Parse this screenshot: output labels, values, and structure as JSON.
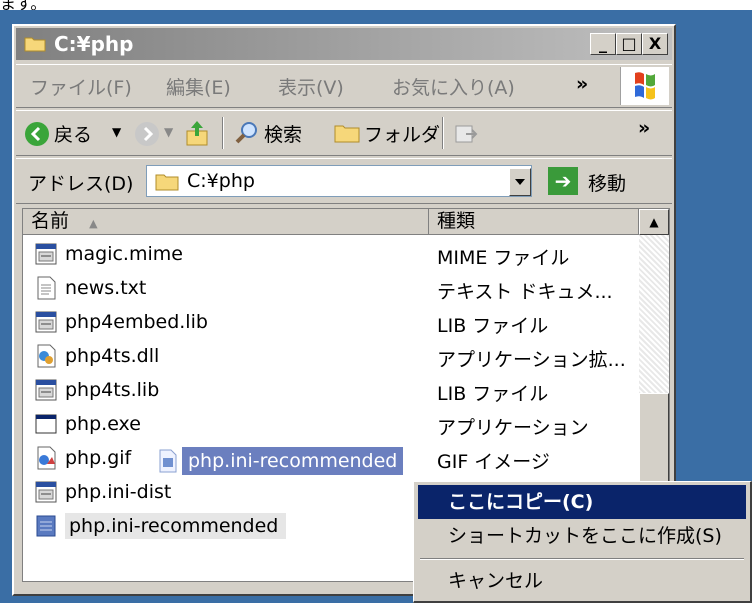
{
  "top_strip_text": "ます。",
  "window": {
    "title": "C:¥php",
    "controls": {
      "minimize": "_",
      "maximize": "□",
      "close": "X"
    }
  },
  "menubar": {
    "items": [
      "ファイル(F)",
      "編集(E)",
      "表示(V)",
      "お気に入り(A)"
    ],
    "chevron": "»"
  },
  "toolbar": {
    "back": "戻る",
    "search": "検索",
    "folders": "フォルダ",
    "chevron": "»"
  },
  "address": {
    "label": "アドレス(D)",
    "value": "C:¥php",
    "go": "移動"
  },
  "list": {
    "headers": {
      "name": "名前",
      "type": "種類"
    },
    "rows": [
      {
        "name": "magic.mime",
        "type": "MIME ファイル",
        "icon": "lib-file-icon"
      },
      {
        "name": "news.txt",
        "type": "テキスト ドキュメ...",
        "icon": "text-file-icon"
      },
      {
        "name": "php4embed.lib",
        "type": "LIB ファイル",
        "icon": "lib-file-icon"
      },
      {
        "name": "php4ts.dll",
        "type": "アプリケーション拡...",
        "icon": "dll-file-icon"
      },
      {
        "name": "php4ts.lib",
        "type": "LIB ファイル",
        "icon": "lib-file-icon"
      },
      {
        "name": "php.exe",
        "type": "アプリケーション",
        "icon": "exe-file-icon"
      },
      {
        "name": "php.gif",
        "type": "GIF イメージ",
        "icon": "gif-file-icon"
      },
      {
        "name": "php.ini-dist",
        "type": "",
        "icon": "lib-file-icon"
      },
      {
        "name": "php.ini-recommended",
        "type": "",
        "icon": "ini-file-icon"
      }
    ]
  },
  "drag_ghost": {
    "label": "php.ini-recommended"
  },
  "context_menu": {
    "copy_here": "ここにコピー(C)",
    "create_shortcut": "ショートカットをここに作成(S)",
    "cancel": "キャンセル"
  },
  "colors": {
    "desktop": "#3a6ea5",
    "highlight": "#0a246a",
    "window_bg": "#d4d0c8"
  }
}
